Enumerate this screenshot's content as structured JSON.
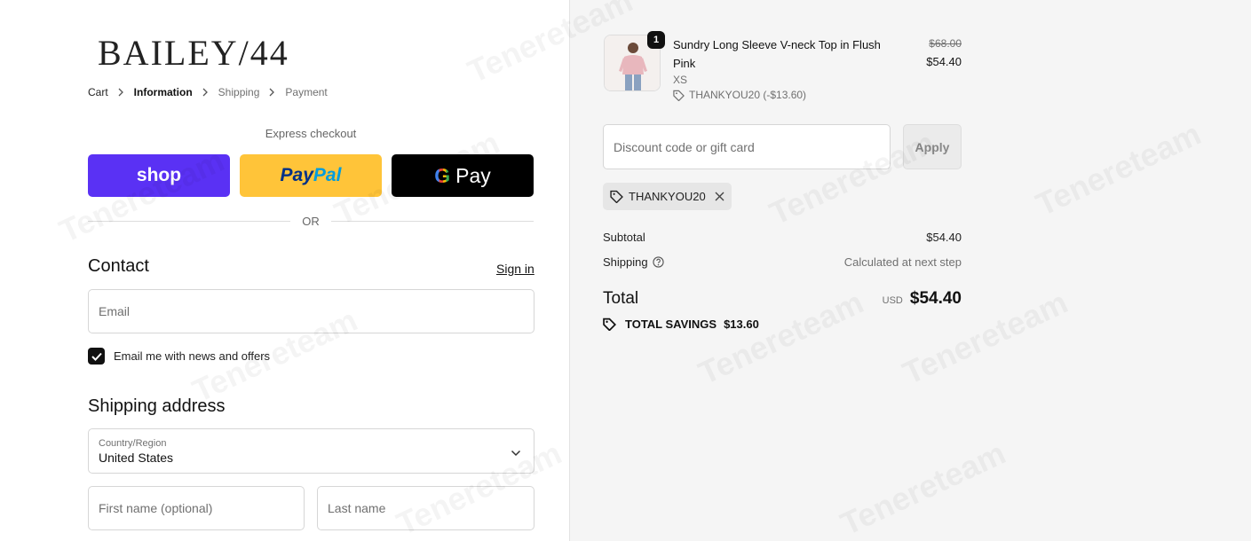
{
  "brand": {
    "logo_text": "BAILEY/44"
  },
  "breadcrumb": {
    "items": [
      "Cart",
      "Information",
      "Shipping",
      "Payment"
    ]
  },
  "express": {
    "label": "Express checkout",
    "shop_label": "shop",
    "paypal_part1": "Pay",
    "paypal_part2": "Pal",
    "gpay_g": "G",
    "gpay_label": "Pay",
    "divider_text": "OR"
  },
  "contact": {
    "title": "Contact",
    "signin_label": "Sign in",
    "email_placeholder": "Email",
    "newsletter_label": "Email me with news and offers",
    "newsletter_checked": true
  },
  "shipping": {
    "title": "Shipping address",
    "country_label": "Country/Region",
    "country_value": "United States",
    "first_name_placeholder": "First name (optional)",
    "last_name_placeholder": "Last name"
  },
  "order": {
    "quantity": "1",
    "product_name": "Sundry Long Sleeve V-neck Top in Flush Pink",
    "variant": "XS",
    "line_discount": "THANKYOU20 (-$13.60)",
    "price_original": "$68.00",
    "price_final": "$54.40"
  },
  "discount": {
    "placeholder": "Discount code or gift card",
    "apply_label": "Apply",
    "applied_code": "THANKYOU20"
  },
  "summary": {
    "subtotal_label": "Subtotal",
    "subtotal_value": "$54.40",
    "shipping_label": "Shipping",
    "shipping_value": "Calculated at next step",
    "total_label": "Total",
    "currency": "USD",
    "total_value": "$54.40",
    "savings_label": "TOTAL SAVINGS",
    "savings_value": "$13.60"
  },
  "watermark": "Tenereteam",
  "colors": {
    "shop_purple": "#5a31f4",
    "paypal_yellow": "#ffc439",
    "gpay_black": "#000000",
    "summary_bg": "#f5f5f5"
  }
}
